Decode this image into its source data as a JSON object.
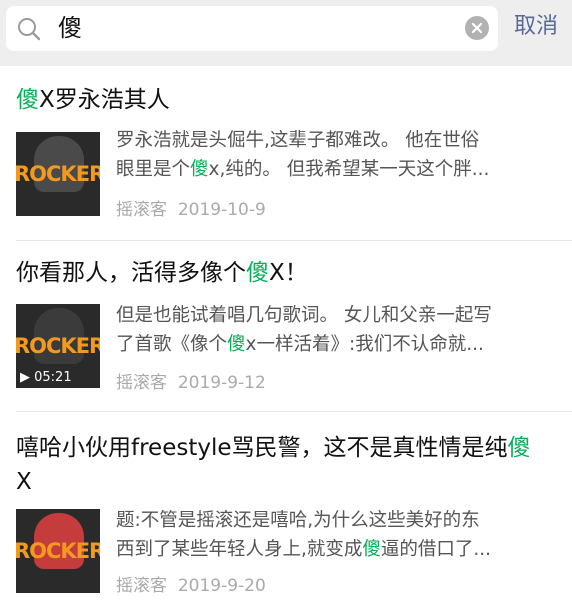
{
  "search": {
    "query": "傻",
    "cancel_label": "取消"
  },
  "results": [
    {
      "title": [
        "傻",
        "X罗永浩其人"
      ],
      "desc_line1": [
        "罗永浩就是头倔牛,这辈子都难改。 他在世俗"
      ],
      "desc_line2": [
        "眼里是个",
        "傻",
        "x,纯的。 但我希望某一天这个胖..."
      ],
      "thumb_text": "ROCKER",
      "source": "摇滚客",
      "date": "2019-10-9"
    },
    {
      "title": [
        "你看那人，活得多像个",
        "傻",
        "X！"
      ],
      "desc_line1": [
        "但是也能试着唱几句歌词。 女儿和父亲一起写"
      ],
      "desc_line2": [
        "了首歌《像个",
        "傻",
        "x一样活着》:我们不认命就..."
      ],
      "thumb_text": "ROCKER",
      "duration": "▶ 05:21",
      "source": "摇滚客",
      "date": "2019-9-12"
    },
    {
      "title": [
        "嘻哈小伙用freestyle骂民警，这不是真性情是纯",
        "傻"
      ],
      "title_line2": "X",
      "desc_line1": [
        "题:不管是摇滚还是嘻哈,为什么这些美好的东"
      ],
      "desc_line2": [
        "西到了某些年轻人身上,就变成",
        "傻",
        "逼的借口了..."
      ],
      "thumb_text": "ROCKER",
      "source": "摇滚客",
      "date": "2019-9-20"
    }
  ]
}
